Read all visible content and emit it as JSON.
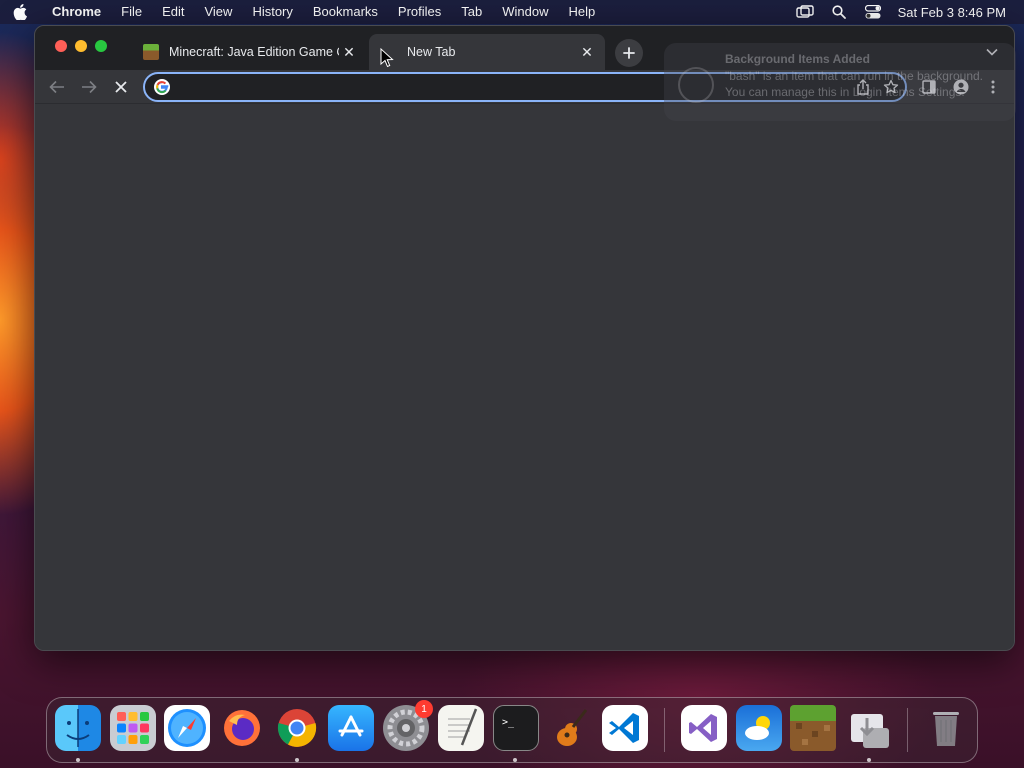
{
  "menubar": {
    "app_name": "Chrome",
    "items": [
      "File",
      "Edit",
      "View",
      "History",
      "Bookmarks",
      "Profiles",
      "Tab",
      "Window",
      "Help"
    ],
    "clock": "Sat Feb 3  8:46 PM"
  },
  "browser": {
    "tabs": [
      {
        "title": "Minecraft: Java Edition Game C",
        "favicon": "minecraft-icon",
        "active": false
      },
      {
        "title": "New Tab",
        "favicon": "none",
        "active": true
      }
    ],
    "omnibox": {
      "value": "",
      "placeholder": ""
    }
  },
  "notification": {
    "title": "Background Items Added",
    "body": "\"bash\" is an item that can run in the background. You can manage this in Login Items Settings."
  },
  "dock": {
    "apps": [
      "Finder",
      "Launchpad",
      "Safari",
      "Firefox",
      "Chrome",
      "App Store",
      "System Settings",
      "TextEdit",
      "Terminal",
      "GarageBand",
      "Visual Studio Code",
      "Visual Studio",
      "Weather",
      "Minecraft",
      "Downloads",
      "Trash"
    ],
    "system_settings_badge": "1"
  },
  "colors": {
    "tabstrip": "#202124",
    "toolbar": "#35363a",
    "omnibox_focus": "#8ab4f8"
  }
}
